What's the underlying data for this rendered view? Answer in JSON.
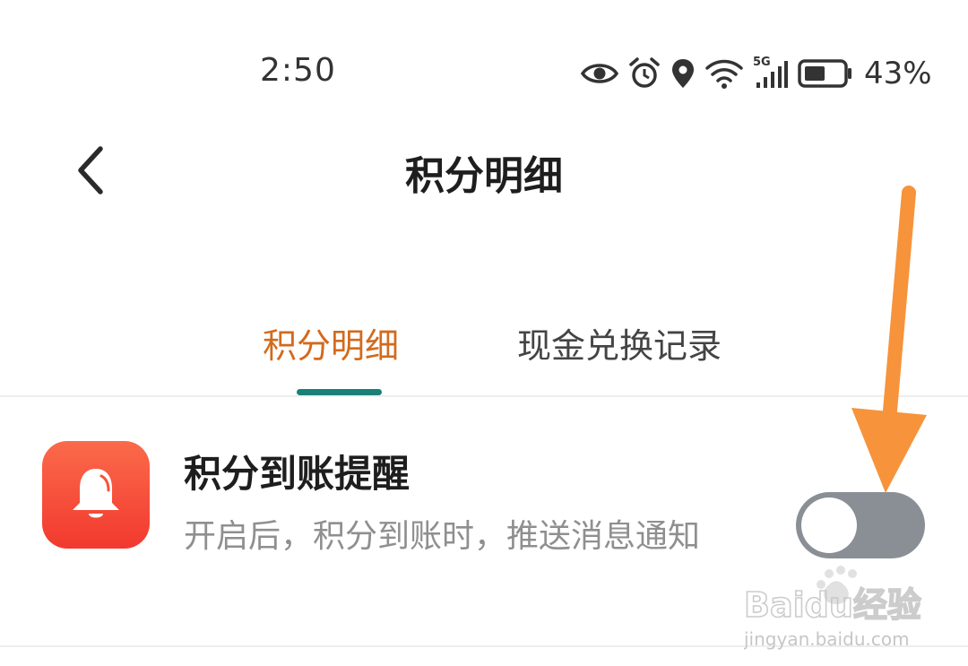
{
  "status_bar": {
    "time": "2:50",
    "network_label": "5G",
    "battery_percent": "43%"
  },
  "header": {
    "title": "积分明细"
  },
  "tabs": [
    {
      "label": "积分明细",
      "active": true
    },
    {
      "label": "现金兑换记录",
      "active": false
    }
  ],
  "notification_setting": {
    "title": "积分到账提醒",
    "description": "开启后，积分到账时，推送消息通知",
    "enabled": false
  },
  "watermark": {
    "brand_text": "Baidu经验",
    "url_text": "jingyan.baidu.com"
  },
  "colors": {
    "active_tab": "#d36a1d",
    "tab_indicator": "#1a8077",
    "app_icon": "#f2392f",
    "toggle_off": "#8a8f96",
    "annotation_arrow": "#f7933b"
  }
}
